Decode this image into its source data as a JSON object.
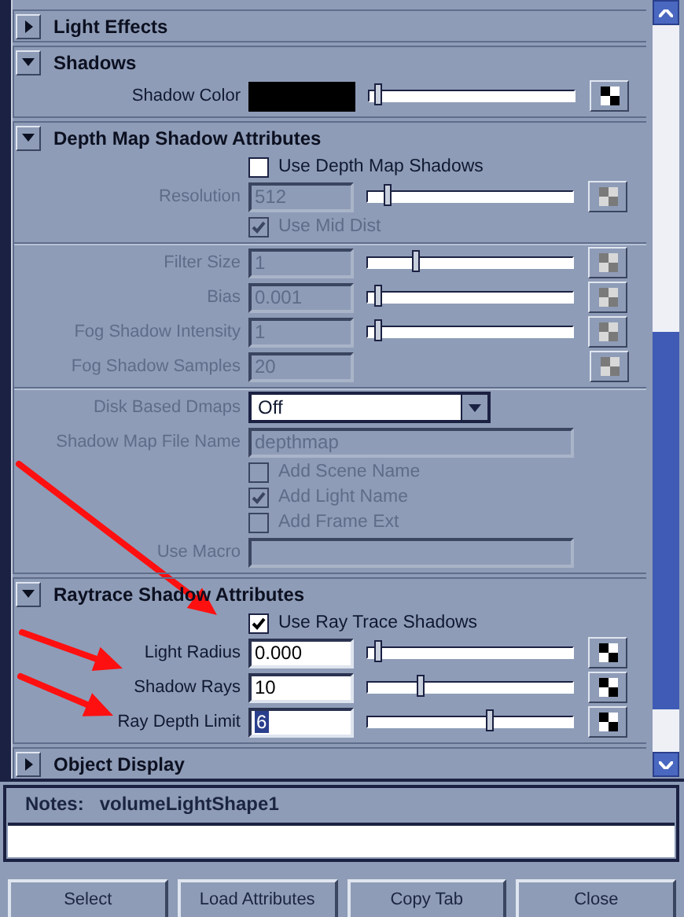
{
  "sections": [
    {
      "title": "Light Effects",
      "expanded": false
    },
    {
      "title": "Shadows",
      "expanded": true,
      "groups": [
        [
          {
            "kind": "color",
            "label": "Shadow Color",
            "color": "#000000",
            "level": 0.02,
            "disabled": false
          }
        ]
      ]
    },
    {
      "title": "Depth Map Shadow Attributes",
      "expanded": true,
      "groups": [
        [
          {
            "kind": "check",
            "label": "Use Depth Map Shadows",
            "checked": false,
            "disabled": false
          },
          {
            "kind": "number",
            "label": "Resolution",
            "value": "512",
            "level": 0.08,
            "disabled": true,
            "text_selected": false
          },
          {
            "kind": "check",
            "label": "Use Mid Dist",
            "checked": true,
            "disabled": true
          }
        ],
        [
          {
            "kind": "number",
            "label": "Filter Size",
            "value": "1",
            "level": 0.22,
            "disabled": true,
            "text_selected": false
          },
          {
            "kind": "number",
            "label": "Bias",
            "value": "0.001",
            "level": 0.03,
            "disabled": true,
            "text_selected": false
          },
          {
            "kind": "number",
            "label": "Fog Shadow Intensity",
            "value": "1",
            "level": 0.03,
            "disabled": true,
            "text_selected": false
          },
          {
            "kind": "number",
            "label": "Fog Shadow Samples",
            "value": "20",
            "disabled": true,
            "text_selected": false
          }
        ],
        [
          {
            "kind": "dropdown",
            "label": "Disk Based Dmaps",
            "value": "Off",
            "disabled": true
          },
          {
            "kind": "text",
            "label": "Shadow Map File Name",
            "value": "depthmap",
            "disabled": true
          },
          {
            "kind": "check",
            "label": "Add Scene Name",
            "checked": false,
            "disabled": true
          },
          {
            "kind": "check",
            "label": "Add Light Name",
            "checked": true,
            "disabled": true
          },
          {
            "kind": "check",
            "label": "Add Frame Ext",
            "checked": false,
            "disabled": true
          },
          {
            "kind": "text",
            "label": "Use Macro",
            "disabled": true
          }
        ]
      ]
    },
    {
      "title": "Raytrace Shadow Attributes",
      "expanded": true,
      "groups": [
        [
          {
            "kind": "check",
            "label": "Use Ray Trace Shadows",
            "checked": true,
            "disabled": false
          },
          {
            "kind": "number",
            "label": "Light Radius",
            "value": "0.000",
            "level": 0.03,
            "disabled": false,
            "text_selected": false
          },
          {
            "kind": "number",
            "label": "Shadow Rays",
            "value": "10",
            "level": 0.25,
            "disabled": false,
            "text_selected": false
          },
          {
            "kind": "number",
            "label": "Ray Depth Limit",
            "value": "6",
            "level": 0.6,
            "disabled": false,
            "text_selected": true
          }
        ]
      ]
    },
    {
      "title": "Object Display",
      "expanded": false
    }
  ],
  "notes": {
    "label": "Notes:",
    "node": "volumeLightShape1"
  },
  "buttons": [
    "Select",
    "Load Attributes",
    "Copy Tab",
    "Close"
  ]
}
